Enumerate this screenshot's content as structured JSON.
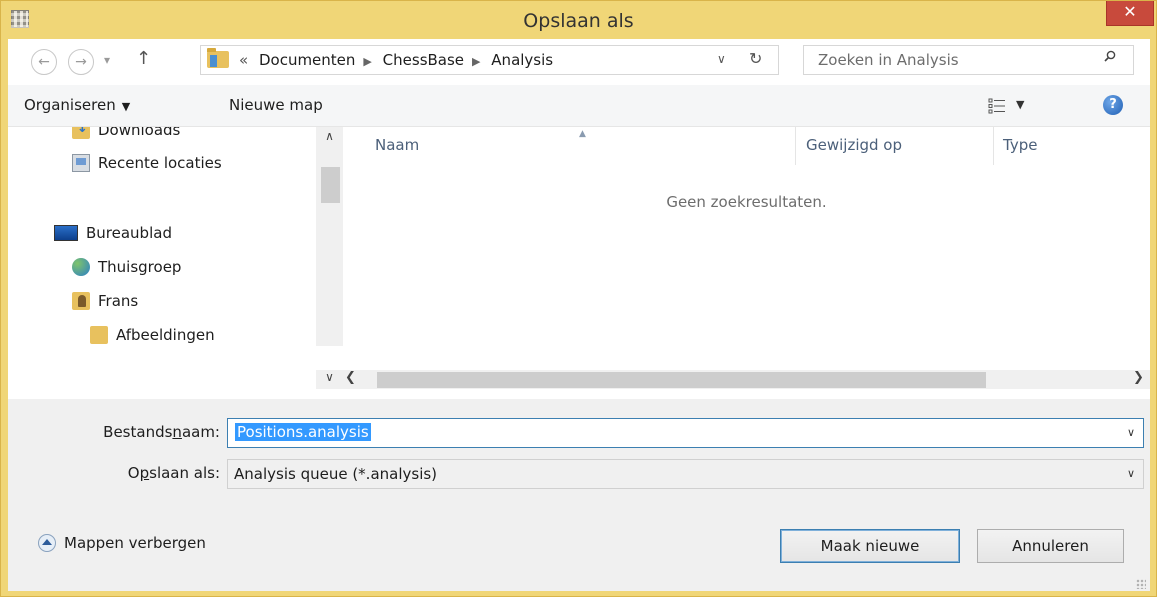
{
  "window": {
    "title": "Opslaan als",
    "close_label": "✕"
  },
  "nav": {
    "back_icon": "back-arrow-icon",
    "forward_icon": "forward-arrow-icon",
    "up_icon": "up-arrow-icon",
    "breadcrumb_prefix": "«",
    "breadcrumbs": [
      "Documenten",
      "ChessBase",
      "Analysis"
    ],
    "search_placeholder": "Zoeken in Analysis"
  },
  "toolbar": {
    "organize": "Organiseren",
    "new_folder": "Nieuwe map"
  },
  "tree": {
    "items": [
      {
        "label": "Downloads",
        "icon": "downloads-folder-icon"
      },
      {
        "label": "Recente locaties",
        "icon": "recent-places-icon"
      },
      {
        "label": "Bureaublad",
        "icon": "desktop-icon"
      },
      {
        "label": "Thuisgroep",
        "icon": "homegroup-icon"
      },
      {
        "label": "Frans",
        "icon": "user-folder-icon"
      },
      {
        "label": "Afbeeldingen",
        "icon": "pictures-folder-icon"
      }
    ]
  },
  "list": {
    "columns": [
      "Naam",
      "Gewijzigd op",
      "Type"
    ],
    "empty_text": "Geen zoekresultaten."
  },
  "form": {
    "filename_label_pre": "Bestands",
    "filename_label_ul": "n",
    "filename_label_post": "aam:",
    "filename_value": "Positions.analysis",
    "savetype_label_pre": "O",
    "savetype_label_ul": "p",
    "savetype_label_post": "slaan als:",
    "savetype_value": "Analysis queue (*.analysis)"
  },
  "footer": {
    "hide_folders": "Mappen verbergen",
    "save_button": "Maak nieuwe",
    "cancel_button": "Annuleren"
  },
  "colors": {
    "titlebar": "#f0d677",
    "close_button": "#c84a3c",
    "selection": "#3399ff"
  }
}
